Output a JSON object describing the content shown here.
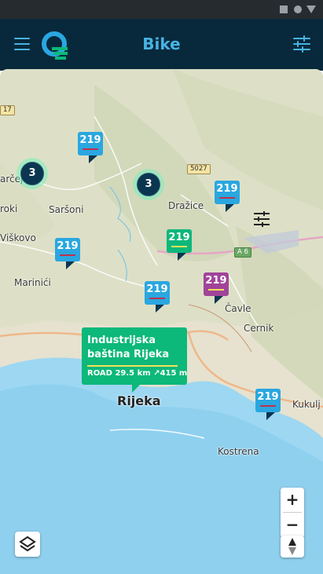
{
  "status_bar": {
    "icons": [
      "square-icon",
      "circle-icon",
      "triangle-icon"
    ]
  },
  "app_bar": {
    "title": "Bike",
    "menu_icon": "hamburger-menu-icon",
    "logo": "app-logo",
    "filter_icon": "sliders-filter-icon"
  },
  "colors": {
    "app_bar_bg": "#08293b",
    "accent": "#47b3e4",
    "marker_blue": "#2aa7e0",
    "marker_green": "#0cb87a",
    "marker_purple": "#a0449a",
    "cluster_ring": "#7ceebc",
    "cluster_core": "#0c3550",
    "popup_bg": "#0cb87a",
    "popup_line": "#f4e15a"
  },
  "map": {
    "place_labels": {
      "rijeka": "Rijeka",
      "drazice": "Dražice",
      "sarsoni": "Saršoni",
      "viskovo": "Viškovo",
      "marinici": "Marinići",
      "cavle": "Čavle",
      "cernik": "Cernik",
      "kostrena": "Kostrena",
      "kukulj": "Kukulj",
      "arcej": "arčej",
      "roki": "roki"
    },
    "road_badges": {
      "r5027": "5027",
      "a6": "A 6",
      "r17": "17"
    },
    "markers": [
      {
        "label": "219",
        "color": "blue"
      },
      {
        "label": "219",
        "color": "blue"
      },
      {
        "label": "219",
        "color": "blue"
      },
      {
        "label": "219",
        "color": "green"
      },
      {
        "label": "219",
        "color": "purple"
      },
      {
        "label": "219",
        "color": "blue"
      },
      {
        "label": "219",
        "color": "blue"
      }
    ],
    "clusters": [
      {
        "count": "3"
      },
      {
        "count": "3"
      }
    ],
    "popup": {
      "title_line1": "Industrijska",
      "title_line2": "baština Rijeka",
      "type": "ROAD",
      "distance": "29.5 km",
      "ascent": "415 m"
    },
    "controls": {
      "zoom_in": "+",
      "zoom_out": "−",
      "compass_icon": "compass-icon",
      "layers_icon": "layers-icon",
      "map_filter_icon": "sliders-filter-icon"
    }
  }
}
